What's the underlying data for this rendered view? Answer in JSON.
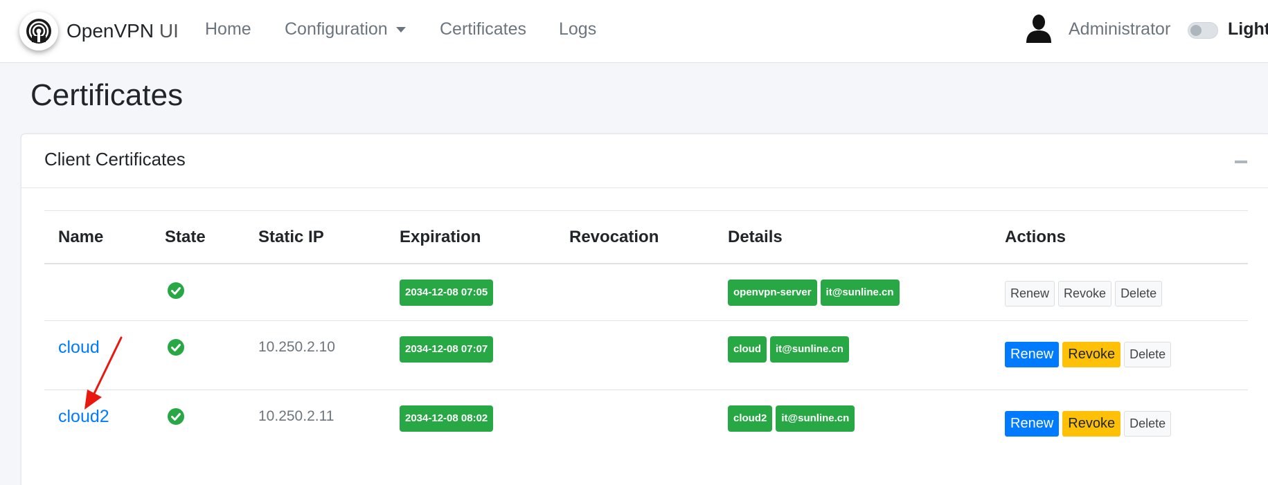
{
  "navbar": {
    "brand": "OpenVPN",
    "brand_suffix": "UI",
    "links": [
      "Home",
      "Configuration",
      "Certificates",
      "Logs"
    ],
    "user": "Administrator",
    "theme_label": "Light"
  },
  "page": {
    "title": "Certificates"
  },
  "card": {
    "title": "Client Certificates"
  },
  "table": {
    "columns": [
      "Name",
      "State",
      "Static IP",
      "Expiration",
      "Revocation",
      "Details",
      "Actions"
    ],
    "rows": [
      {
        "name": "",
        "state": "valid",
        "static_ip": "",
        "expiration": "2034-12-08 07:05",
        "revocation": "",
        "details": [
          "openvpn-server",
          "it@sunline.cn"
        ],
        "actions": [
          "Renew",
          "Revoke",
          "Delete"
        ]
      },
      {
        "name": "cloud",
        "state": "valid",
        "static_ip": "10.250.2.10",
        "expiration": "2034-12-08 07:07",
        "revocation": "",
        "details": [
          "cloud",
          "it@sunline.cn"
        ],
        "actions": [
          "Renew",
          "Revoke",
          "Delete"
        ]
      },
      {
        "name": "cloud2",
        "state": "valid",
        "static_ip": "10.250.2.11",
        "expiration": "2034-12-08 08:02",
        "revocation": "",
        "details": [
          "cloud2",
          "it@sunline.cn"
        ],
        "actions": [
          "Renew",
          "Revoke",
          "Delete"
        ]
      }
    ]
  },
  "colors": {
    "success": "#28a745",
    "primary": "#007bff",
    "warning": "#ffc107",
    "annotation_arrow": "#e8170f"
  },
  "icons": {
    "brand": "openvpn-logo-icon",
    "user": "user-silhouette-icon",
    "state": "check-circle-icon",
    "collapse": "minus-icon",
    "annotation": "red-arrow-icon"
  }
}
